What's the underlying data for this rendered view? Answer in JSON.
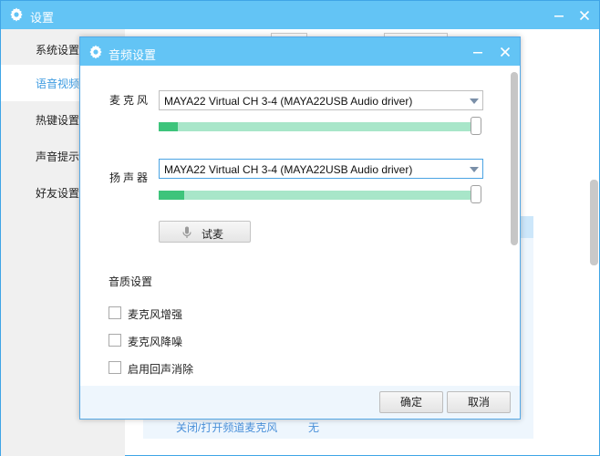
{
  "outer_window": {
    "title": "设置",
    "sidebar": [
      {
        "label": "系统设置",
        "active": false
      },
      {
        "label": "语音视频",
        "active": true
      },
      {
        "label": "热键设置",
        "active": false
      },
      {
        "label": "声音提示",
        "active": false
      },
      {
        "label": "好友设置",
        "active": false
      }
    ],
    "hotkey_row": {
      "label": "关闭/打开频道麦克风",
      "value": "无"
    }
  },
  "dialog": {
    "title": "音频设置",
    "microphone": {
      "label": "麦克风",
      "device": "MAYA22 Virtual CH 3-4 (MAYA22USB Audio driver)",
      "level": 0.06
    },
    "speaker": {
      "label": "扬声器",
      "device": "MAYA22 Virtual CH 3-4 (MAYA22USB Audio driver)",
      "level": 0.08
    },
    "test_button": "试麦",
    "quality_section": "音质设置",
    "options": [
      {
        "label": "麦克风增强",
        "checked": false
      },
      {
        "label": "麦克风降噪",
        "checked": false
      },
      {
        "label": "启用回声消除",
        "checked": false
      }
    ],
    "ok_button": "确定",
    "cancel_button": "取消"
  },
  "colors": {
    "title_bar": "#63c4f5",
    "accent": "#3d9be0",
    "meter_fill": "#3dc47b",
    "meter_track": "#a8e6c9"
  },
  "icons": {
    "title_icon": "gear-icon",
    "minimize": "minimize-icon",
    "close": "close-icon",
    "test_icon": "microphone-icon"
  }
}
